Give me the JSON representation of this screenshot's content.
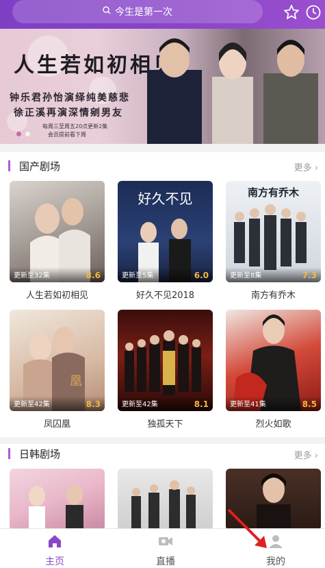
{
  "colors": {
    "brand": "#8b45c9",
    "score": "#f3b740",
    "accent_bar": "#b05ad0"
  },
  "search": {
    "placeholder_text": "今生是第一次",
    "icon": "search-icon"
  },
  "topbar": {
    "icons": [
      "star-icon",
      "history-clock-icon"
    ]
  },
  "banner": {
    "title": "人生若如初相见",
    "line1": "钟乐君孙怡演绎纯美慈悲",
    "line2": "徐正溪再演深情剜男友",
    "line3": "每周三至周五20点更新2集",
    "line4": "会员提前看下周",
    "dots": 2
  },
  "sections": [
    {
      "title": "国产剧场",
      "more": "更多",
      "items": [
        {
          "status": "更新至32集",
          "score": "8.6",
          "name": "人生若如初相见"
        },
        {
          "status": "更新至5集",
          "score": "6.0",
          "name": "好久不见2018",
          "poster_text": "好久不见"
        },
        {
          "status": "更新至8集",
          "score": "7.3",
          "name": "南方有乔木",
          "poster_text": "南方有乔木"
        },
        {
          "status": "更新至42集",
          "score": "8.3",
          "name": "凤囚凰"
        },
        {
          "status": "更新至42集",
          "score": "8.1",
          "name": "独孤天下"
        },
        {
          "status": "更新至41集",
          "score": "8.5",
          "name": "烈火如歌"
        }
      ]
    },
    {
      "title": "日韩剧场",
      "more": "更多"
    }
  ],
  "bottom_nav": {
    "items": [
      {
        "label": "主页",
        "icon": "home-icon",
        "active": true
      },
      {
        "label": "直播",
        "icon": "video-camera-icon",
        "active": false
      },
      {
        "label": "我的",
        "icon": "user-profile-icon",
        "active": false
      }
    ]
  }
}
